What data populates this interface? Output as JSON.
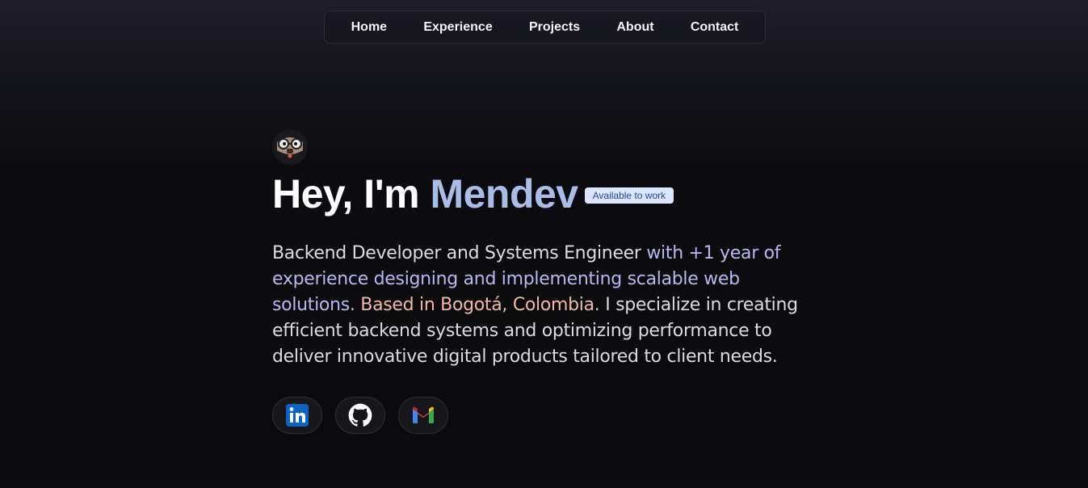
{
  "nav": {
    "items": [
      "Home",
      "Experience",
      "Projects",
      "About",
      "Contact"
    ]
  },
  "hero": {
    "greeting": "Hey, I'm",
    "name": "Mendev",
    "badge": "Available to work",
    "bio": {
      "part1": "Backend Developer and Systems Engineer",
      "part2": " with +1 year of experience designing and implementing scalable web solutions.",
      "part3": " Based in Bogotá, Colombia.",
      "part4": " I specialize in creating efficient backend systems and optimizing performance to deliver innovative digital products tailored to client needs."
    }
  },
  "socials": [
    {
      "icon": "linkedin-icon"
    },
    {
      "icon": "github-icon"
    },
    {
      "icon": "gmail-icon"
    }
  ],
  "colors": {
    "accent_name": "#a9bde8",
    "badge_bg": "#dbe7ff",
    "bio_highlight": "#b9b6f2",
    "location": "#f2b8a8"
  }
}
